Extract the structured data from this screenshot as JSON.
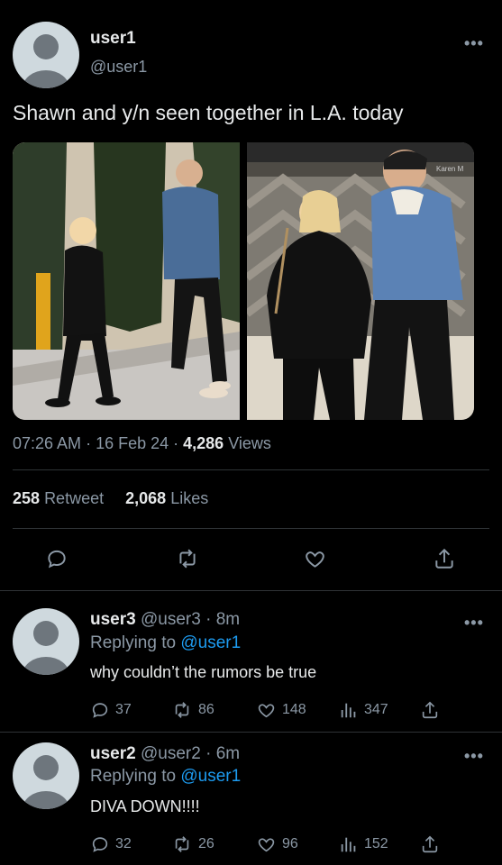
{
  "tweet": {
    "display_name": "user1",
    "handle": "@user1",
    "text": "Shawn and y/n seen together in L.A. today",
    "time": "07:26 AM",
    "date": "16 Feb 24",
    "views_count": "4,286",
    "views_label": "Views",
    "retweets_count": "258",
    "retweets_label": "Retweet",
    "likes_count": "2,068",
    "likes_label": "Likes",
    "photo_credit": "Karen M"
  },
  "replies": [
    {
      "display_name": "user3",
      "handle": "@user3",
      "age": "8m",
      "replying_to_label": "Replying to",
      "replying_to": "@user1",
      "text": "why couldn’t the rumors be true",
      "replies": "37",
      "retweets": "86",
      "likes": "148",
      "views": "347"
    },
    {
      "display_name": "user2",
      "handle": "@user2",
      "age": "6m",
      "replying_to_label": "Replying to",
      "replying_to": "@user1",
      "text": "DIVA DOWN!!!!",
      "replies": "32",
      "retweets": "26",
      "likes": "96",
      "views": "152"
    }
  ],
  "colors": {
    "background": "#000000",
    "accent": "#1d9bf0",
    "muted": "#8b98a5",
    "divider": "#2f3336"
  },
  "icons": [
    "more-icon",
    "reply-icon",
    "retweet-icon",
    "like-icon",
    "share-icon",
    "views-icon"
  ]
}
